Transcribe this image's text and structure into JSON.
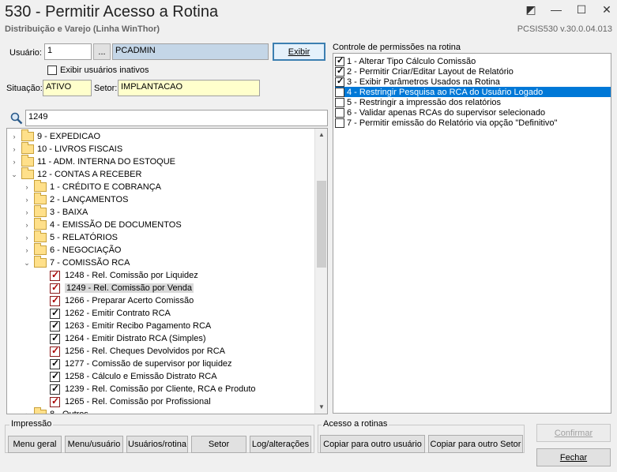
{
  "window": {
    "title": "530 - Permitir Acesso a Rotina",
    "subtitle": "Distribuição e Varejo (Linha WinThor)",
    "version": "PCSIS530  v.30.0.04.013",
    "controls": [
      "◩",
      "—",
      "☐",
      "✕"
    ]
  },
  "user": {
    "label": "Usuário:",
    "id": "1",
    "lookup": "...",
    "name": "PCADMIN",
    "exibir_button": "Exibir",
    "inactive_label": "Exibir usuários inativos"
  },
  "situacao": {
    "label": "Situação:",
    "value": "ATIVO"
  },
  "setor": {
    "label": "Setor:",
    "value": "IMPLANTACAO"
  },
  "search": {
    "value": "1249"
  },
  "tree": [
    {
      "label": "9 - EXPEDICAO",
      "arrow": "›",
      "type": "folder"
    },
    {
      "label": "10 - LIVROS FISCAIS",
      "arrow": "›",
      "type": "folder"
    },
    {
      "label": "11 - ADM. INTERNA DO ESTOQUE",
      "arrow": "›",
      "type": "folder"
    },
    {
      "label": "12 - CONTAS A RECEBER",
      "arrow": "⌄",
      "type": "folder"
    },
    {
      "label": "1 - CRÉDITO E COBRANÇA",
      "arrow": "›",
      "type": "folder"
    },
    {
      "label": "2 - LANÇAMENTOS",
      "arrow": "›",
      "type": "folder"
    },
    {
      "label": "3 - BAIXA",
      "arrow": "›",
      "type": "folder"
    },
    {
      "label": "4 - EMISSÃO DE DOCUMENTOS",
      "arrow": "›",
      "type": "folder"
    },
    {
      "label": "5 - RELATÓRIOS",
      "arrow": "›",
      "type": "folder"
    },
    {
      "label": "6 - NEGOCIAÇÃO",
      "arrow": "›",
      "type": "folder"
    },
    {
      "label": "7 - COMISSÃO RCA",
      "arrow": "⌄",
      "type": "folder"
    },
    {
      "label": "1248 - Rel. Comissão por Liquidez",
      "type": "leaf",
      "style": "red"
    },
    {
      "label": "1249 - Rel. Comissão por Venda",
      "type": "leaf",
      "style": "red",
      "selected": true
    },
    {
      "label": "1266 - Preparar Acerto Comissão",
      "type": "leaf",
      "style": "red"
    },
    {
      "label": "1262 - Emitir Contrato RCA",
      "type": "leaf",
      "style": "plain"
    },
    {
      "label": "1263 - Emitir Recibo Pagamento RCA",
      "type": "leaf",
      "style": "plain"
    },
    {
      "label": "1264 - Emitir Distrato RCA (Simples)",
      "type": "leaf",
      "style": "plain"
    },
    {
      "label": "1256 - Rel. Cheques Devolvidos por RCA",
      "type": "leaf",
      "style": "red"
    },
    {
      "label": "1277 - Comissão de supervisor por liquidez",
      "type": "leaf",
      "style": "plain"
    },
    {
      "label": "1258 - Cálculo e Emissão Distrato RCA",
      "type": "leaf",
      "style": "plain"
    },
    {
      "label": "1239 - Rel. Comissão por Cliente, RCA e Produto",
      "type": "leaf",
      "style": "plain"
    },
    {
      "label": "1265 - Rel. Comissão por Profissional",
      "type": "leaf",
      "style": "red"
    },
    {
      "label": "8 - Outros",
      "arrow": "›",
      "type": "folder"
    }
  ],
  "permissions": {
    "title": "Controle de permissões na rotina",
    "items": [
      {
        "label": "1 - Alterar Tipo Cálculo Comissão",
        "checked": true
      },
      {
        "label": "2 - Permitir Criar/Editar Layout de Relatório",
        "checked": true
      },
      {
        "label": "3 - Exibir Parâmetros Usados na Rotina",
        "checked": true
      },
      {
        "label": "4 - Restringir Pesquisa ao RCA do Usuário Logado",
        "checked": true,
        "active": true
      },
      {
        "label": "5 - Restringir a impressão dos relatórios",
        "checked": false
      },
      {
        "label": "6 - Validar apenas RCAs do supervisor selecionado",
        "checked": false
      },
      {
        "label": "7 - Permitir emissão do Relatório via opção \"Definitivo\"",
        "checked": false
      }
    ]
  },
  "impressao": {
    "title": "Impressão",
    "buttons": [
      "Menu geral",
      "Menu/usuário",
      "Usuários/rotina",
      "Setor",
      "Log/alterações"
    ]
  },
  "acesso": {
    "title": "Acesso a rotinas",
    "buttons": [
      "Copiar para outro usuário",
      "Copiar para outro Setor"
    ]
  },
  "actions": {
    "confirmar": "Confirmar",
    "fechar": "Fechar"
  }
}
